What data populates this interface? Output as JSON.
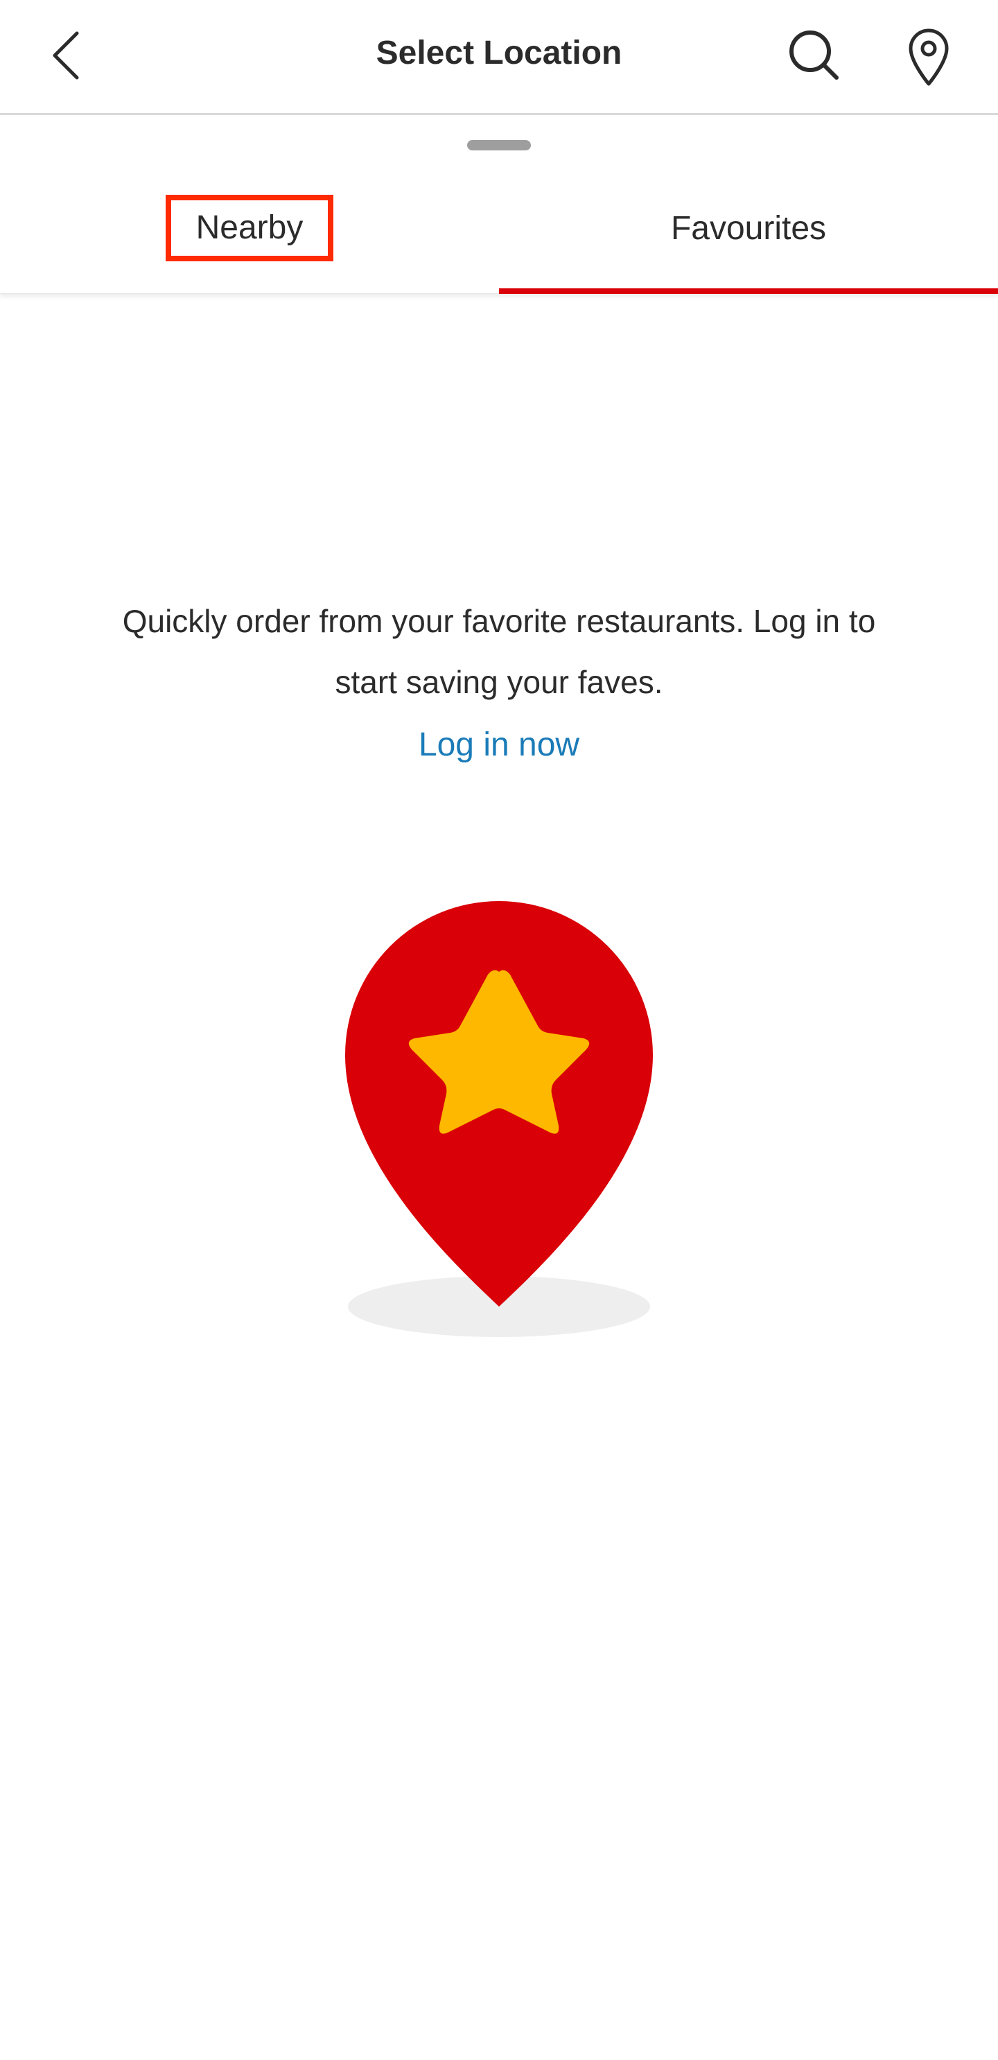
{
  "header": {
    "title": "Select Location",
    "back_icon": "chevron-left-icon",
    "search_icon": "search-icon",
    "location_icon": "map-pin-icon"
  },
  "tabs": [
    {
      "label": "Nearby",
      "selected": false
    },
    {
      "label": "Favourites",
      "selected": true
    }
  ],
  "empty_state": {
    "message": "Quickly order from your favorite restaurants. Log in to start saving your faves.",
    "login_link": "Log in now",
    "illustration": "favorite-pin-illustration"
  },
  "colors": {
    "accent": "#d90007",
    "star": "#ffb800",
    "link": "#1a7bb8",
    "highlight_box": "#ff2a00",
    "text": "#2b2b2b"
  }
}
